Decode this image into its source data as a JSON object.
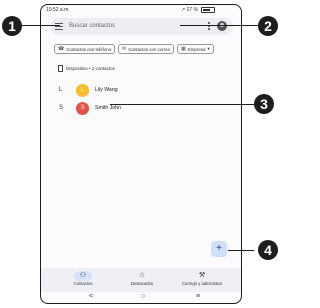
{
  "statusbar": {
    "time": "10:52 a.m.",
    "signal": "▾",
    "battery_text": "↗ 27 %"
  },
  "search": {
    "placeholder": "Buscar contactos"
  },
  "chips": [
    {
      "icon": "phone-icon",
      "glyph": "☎",
      "label": "Contactos con teléfono"
    },
    {
      "icon": "mail-icon",
      "glyph": "✉",
      "label": "Contactos con correo"
    },
    {
      "icon": "business-icon",
      "glyph": "▦",
      "label": "Empresa",
      "dropdown": "▾"
    }
  ],
  "device": {
    "label": "Dispositivo • 2 contactos"
  },
  "contacts": [
    {
      "letter": "L",
      "initial": "L",
      "name": "Lily Wang",
      "color": "#f6bd2e"
    },
    {
      "letter": "S",
      "initial": "S",
      "name": "Smith John",
      "color": "#e4534a"
    }
  ],
  "fab": {
    "glyph": "+"
  },
  "bottomnav": [
    {
      "icon": "person-icon",
      "glyph": "⚇",
      "label": "Contactos",
      "active": true
    },
    {
      "icon": "star-box-icon",
      "glyph": "☆",
      "label": "Destacados"
    },
    {
      "icon": "wrench-icon",
      "glyph": "⚒",
      "label": "Corregir y administrar"
    }
  ],
  "sysnav": {
    "back": "<",
    "home": "○",
    "recents": "≡"
  },
  "callouts": [
    "1",
    "2",
    "3",
    "4"
  ]
}
